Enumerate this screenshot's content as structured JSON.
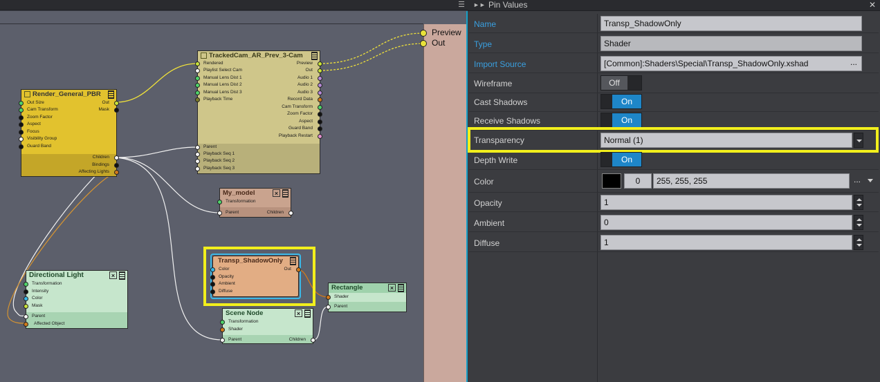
{
  "graph": {
    "menu_icon": "hamburger-icon",
    "out_pins": {
      "preview": "Preview",
      "out": "Out"
    },
    "nodes": {
      "render": {
        "title": "Render_General_PBR",
        "inputs": [
          "Out Size",
          "Cam Transform",
          "Zoom Factor",
          "Aspect",
          "Focus",
          "Visibility Group",
          "Guard Band"
        ],
        "outputs": [
          "Out",
          "Mask"
        ],
        "lower_outputs": [
          "Children",
          "Bindings",
          "Affecting Lights"
        ]
      },
      "tracked": {
        "title": "TrackedCam_AR_Prev_3-Cam",
        "inputs": [
          "Rendered",
          "Playlist Select Cam",
          "Manual Lens Dist 1",
          "Manual Lens Dist 2",
          "Manual Lens Dist 3",
          "Playback Time"
        ],
        "outputs": [
          "Preview",
          "Out",
          "Audio 1",
          "Audio 2",
          "Audio 3",
          "Record Data",
          "Cam Transform",
          "Zoom Factor",
          "Aspect",
          "Guard Band",
          "Playback Restart"
        ],
        "lower_inputs": [
          "Parent",
          "Playback Seq 1",
          "Playback Seq 2",
          "Playback Seq 3"
        ]
      },
      "my_model": {
        "title": "My_model",
        "inputs": [
          "Transformation"
        ],
        "parent": "Parent",
        "children": "Children"
      },
      "transp": {
        "title": "Transp_ShadowOnly",
        "inputs": [
          "Color",
          "Opacity",
          "Ambient",
          "Diffuse"
        ],
        "out": "Out"
      },
      "rectangle": {
        "title": "Rectangle",
        "inputs": [
          "Shader"
        ],
        "parent": "Parent"
      },
      "scene_node": {
        "title": "Scene Node",
        "inputs": [
          "Transformation",
          "Shader"
        ],
        "parent": "Parent",
        "children": "Children"
      },
      "dir_light": {
        "title": "Directional Light",
        "inputs": [
          "Transformation",
          "Intensity",
          "Color",
          "Mask"
        ],
        "parent": "Parent",
        "affected": "Affected Object"
      }
    }
  },
  "panel": {
    "title": "Pin Values",
    "rows": [
      {
        "label": "Name",
        "value": "Transp_ShadowOnly"
      },
      {
        "label": "Type",
        "value": "Shader"
      },
      {
        "label": "Import Source",
        "value": "[Common]:Shaders\\Special\\Transp_ShadowOnly.xshad",
        "button": "..."
      },
      {
        "label": "Wireframe",
        "value": "Off"
      },
      {
        "label": "Cast Shadows",
        "value": "On"
      },
      {
        "label": "Receive Shadows",
        "value": "On"
      },
      {
        "label": "Transparency",
        "value": "Normal (1)"
      },
      {
        "label": "Depth Write",
        "value": "On"
      },
      {
        "label": "Color",
        "alpha": "0",
        "rgb": "255, 255, 255",
        "button": "...",
        "swatch": "#000000"
      },
      {
        "label": "Opacity",
        "value": "1"
      },
      {
        "label": "Ambient",
        "value": "0"
      },
      {
        "label": "Diffuse",
        "value": "1"
      }
    ]
  },
  "colors": {
    "graph_bg": "#5c5f6b",
    "highlight": "#f2ef1c",
    "accent_blue": "#1e86c8",
    "render_node": "#e2c22e",
    "tracked_node": "#cfc68a",
    "model_node": "#c9a38e",
    "transp_node": "#e2ad84",
    "green_node": "#c6e6cc"
  }
}
